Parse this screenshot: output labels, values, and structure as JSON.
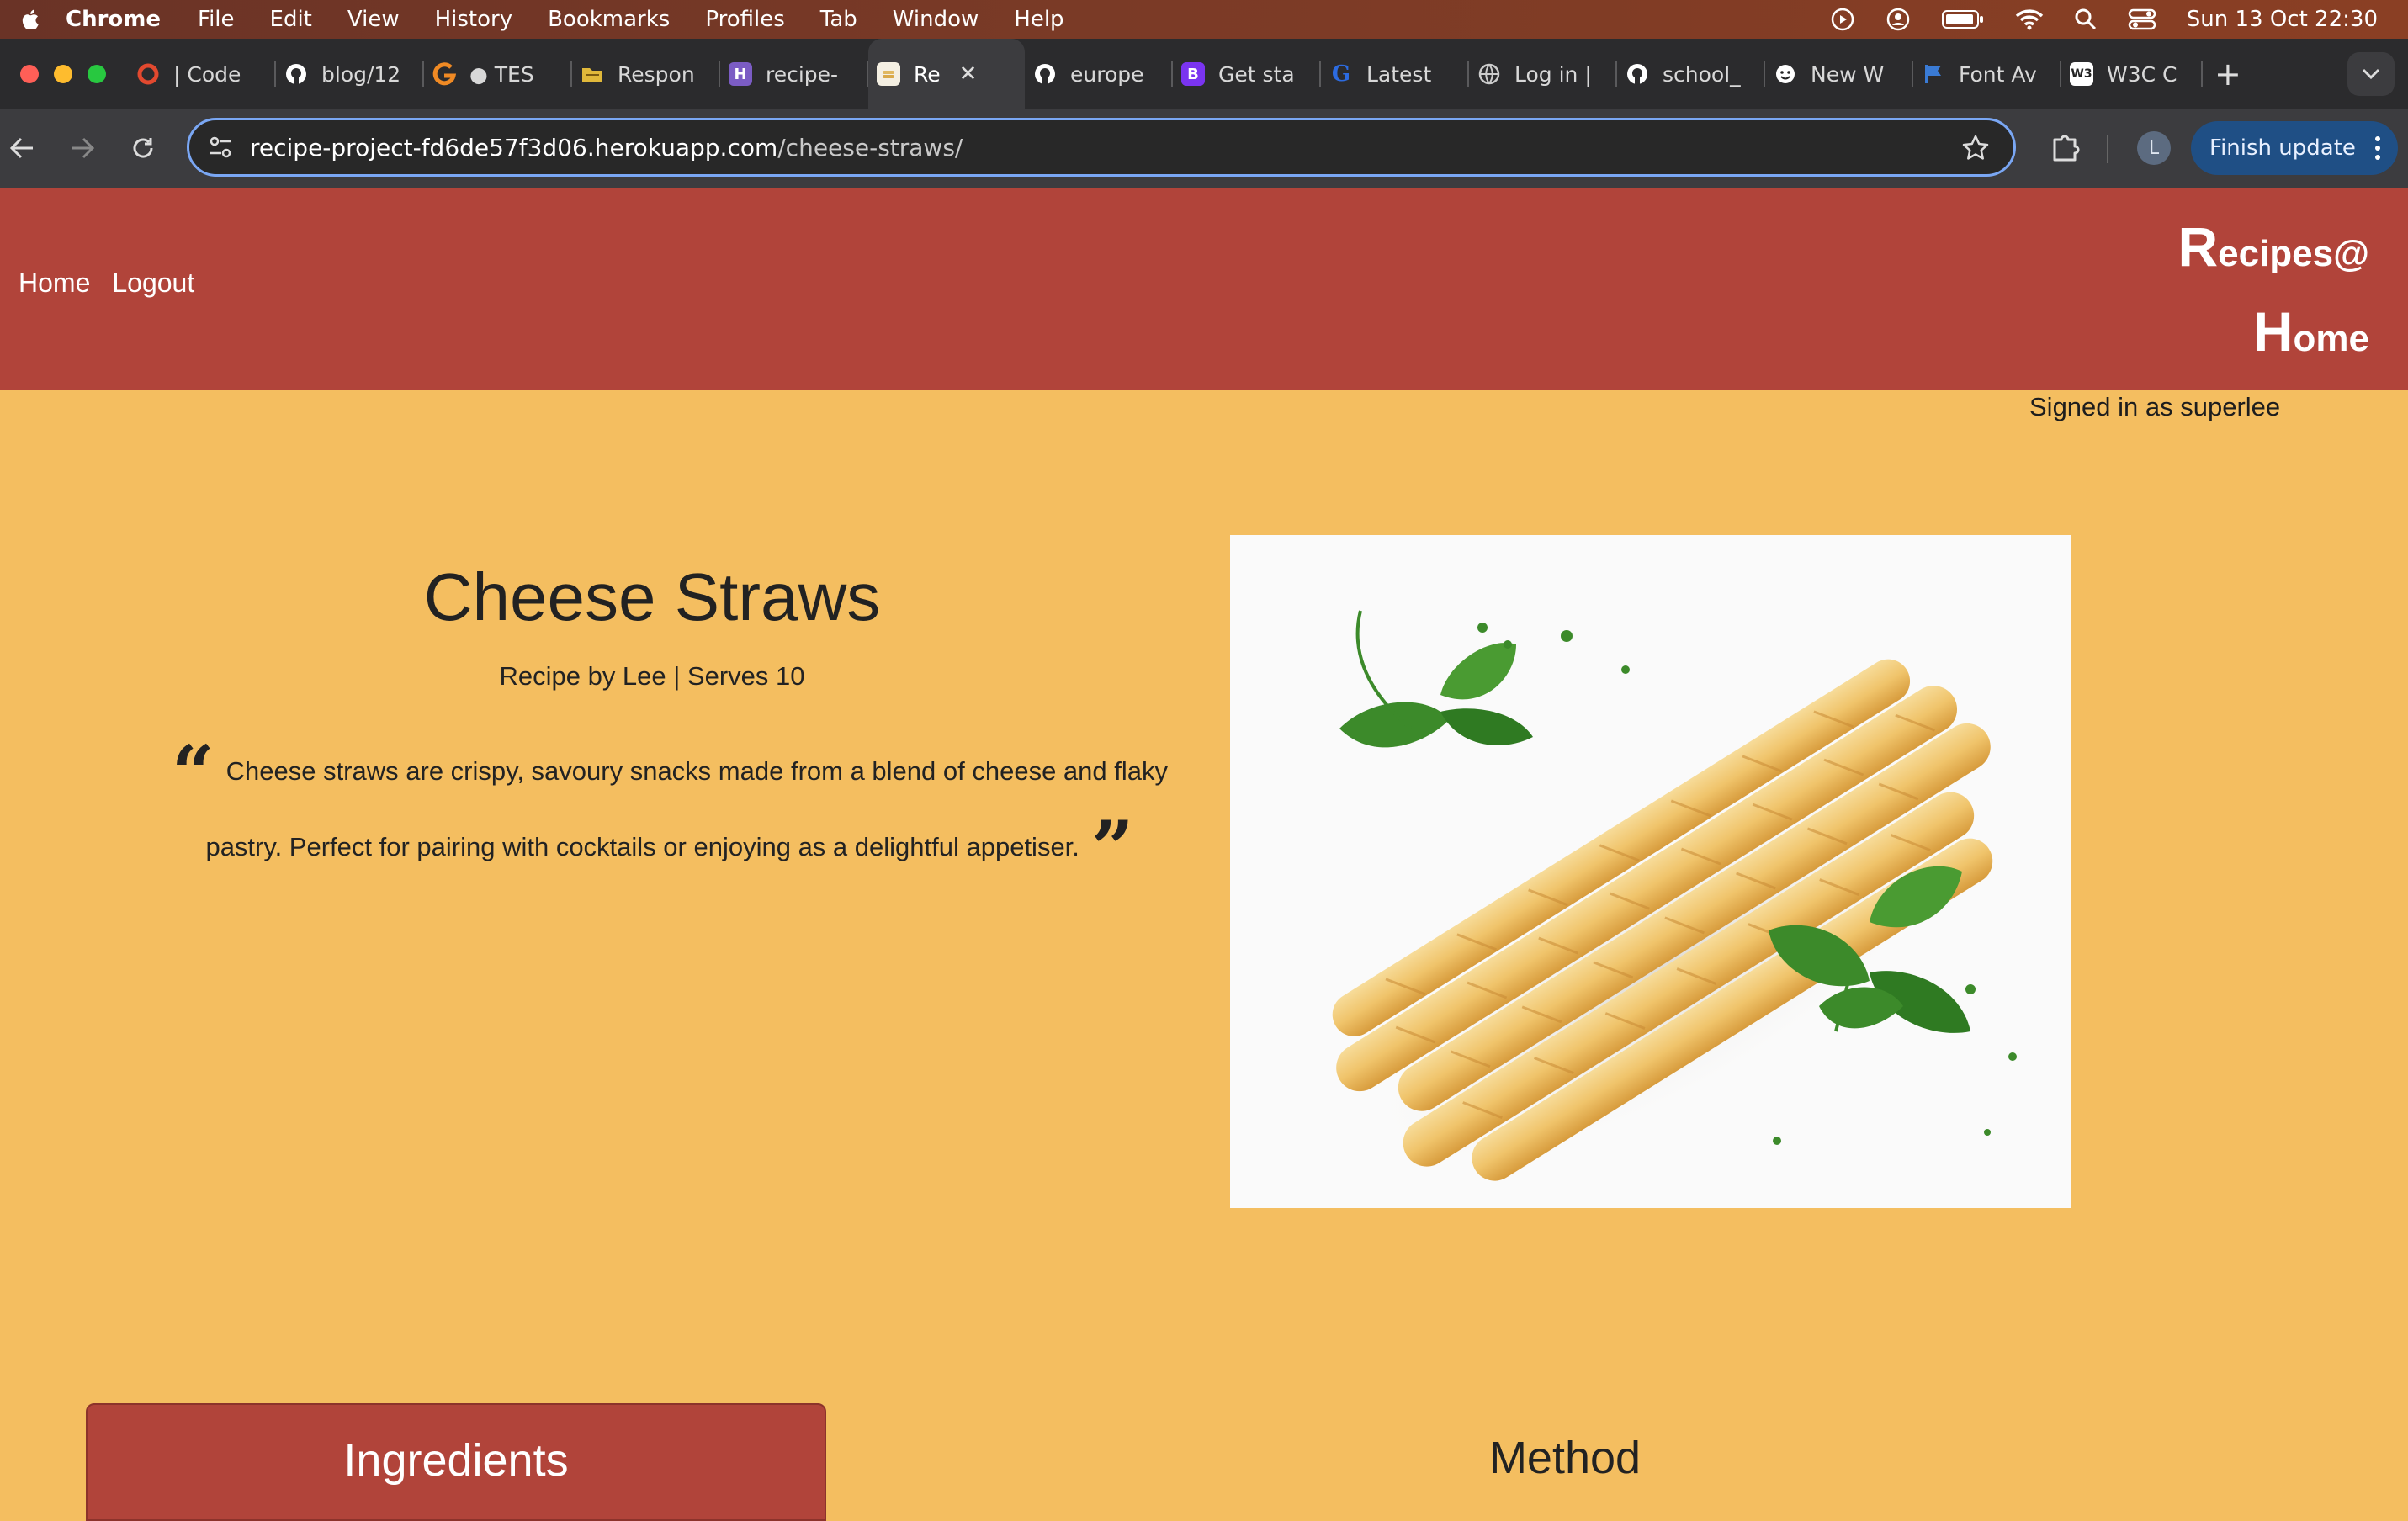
{
  "menubar": {
    "app": "Chrome",
    "items": [
      "File",
      "Edit",
      "View",
      "History",
      "Bookmarks",
      "Profiles",
      "Tab",
      "Window",
      "Help"
    ],
    "clock": "Sun 13 Oct  22:30"
  },
  "tabs": [
    {
      "title": "| Code",
      "icon": "circle-o-icon",
      "color": "#e2492f"
    },
    {
      "title": "blog/12",
      "icon": "github-icon",
      "color": "#ffffff"
    },
    {
      "title": "● TES",
      "icon": "g-icon",
      "color": "#f08a24"
    },
    {
      "title": "Respon",
      "icon": "folder-icon",
      "color": "#e0b83a"
    },
    {
      "title": "recipe-",
      "icon": "heroku-icon",
      "color": "#7b5cc4"
    },
    {
      "title": "Re",
      "icon": "recipe-favicon",
      "color": "#f4be60",
      "active": true
    },
    {
      "title": "europe",
      "icon": "github-icon",
      "color": "#ffffff"
    },
    {
      "title": "Get sta",
      "icon": "bootstrap-icon",
      "color": "#7a34f0"
    },
    {
      "title": "Latest",
      "icon": "g-blue-icon",
      "color": "#2c6be0"
    },
    {
      "title": "Log in |",
      "icon": "globe-icon",
      "color": "#cccccc"
    },
    {
      "title": "school_",
      "icon": "github-icon",
      "color": "#ffffff"
    },
    {
      "title": "New W",
      "icon": "smiley-icon",
      "color": "#ffffff"
    },
    {
      "title": "Font Av",
      "icon": "flag-icon",
      "color": "#3a7bd5"
    },
    {
      "title": "W3C C",
      "icon": "w3c-icon",
      "color": "#ffffff"
    }
  ],
  "toolbar": {
    "url_host": "recipe-project-fd6de57f3d06.herokuapp.com",
    "url_path": "/cheese-straws/",
    "update_label": "Finish update",
    "avatar_letter": "L"
  },
  "site": {
    "nav": {
      "home": "Home",
      "logout": "Logout"
    },
    "brand": {
      "r": "R",
      "ecipes": "ecipes@",
      "h": "H",
      "ome": "ome"
    },
    "signed_in": "Signed in as superlee"
  },
  "recipe": {
    "title": "Cheese Straws",
    "meta": "Recipe by Lee | Serves 10",
    "description": "Cheese straws are crispy, savoury snacks made from a blend of cheese and flaky pastry. Perfect for pairing with cocktails or enjoying as a delightful appetiser.",
    "quote_open": "“",
    "quote_close": "”"
  },
  "sections": {
    "ingredients": "Ingredients",
    "method": "Method"
  }
}
